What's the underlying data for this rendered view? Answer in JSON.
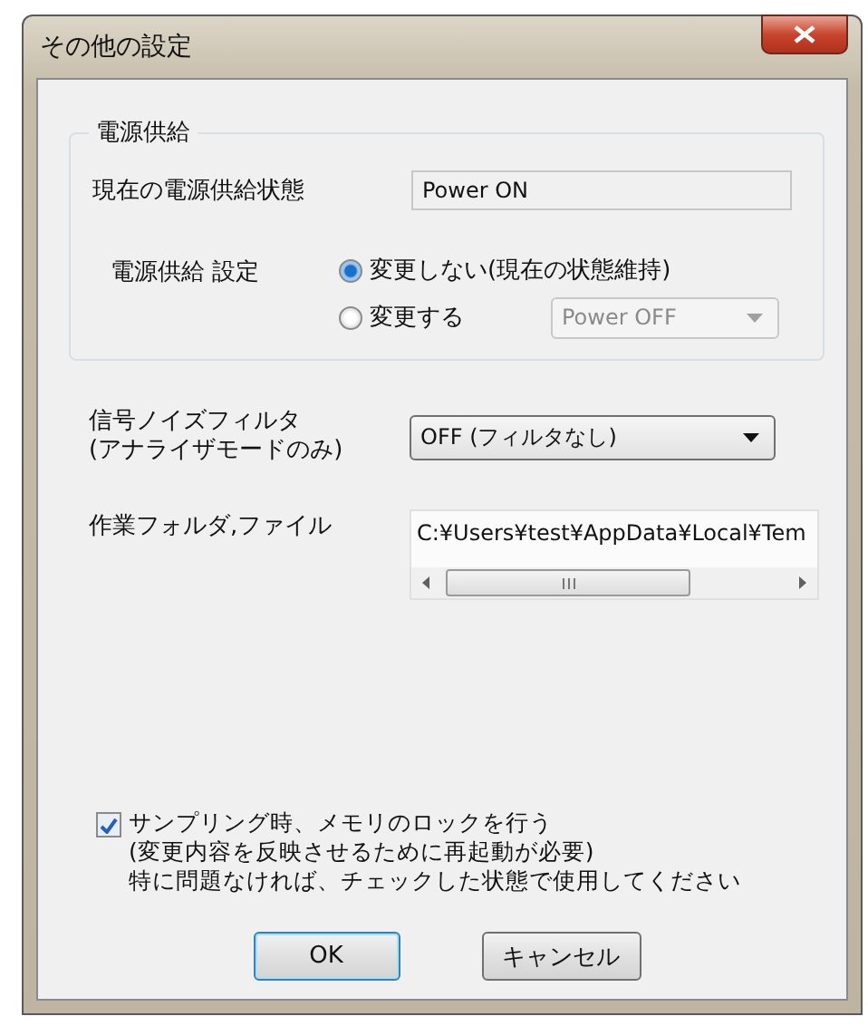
{
  "window": {
    "title": "その他の設定"
  },
  "power_group": {
    "title": "電源供給",
    "current_state": {
      "label": "現在の電源供給状態",
      "value": "Power ON"
    },
    "setting": {
      "label": "電源供給 設定",
      "options": [
        {
          "label": "変更しない(現在の状態維持)",
          "selected": true
        },
        {
          "label": "変更する",
          "selected": false
        }
      ],
      "dropdown": {
        "value": "Power OFF",
        "disabled": true
      }
    }
  },
  "noise_filter": {
    "label_lines": [
      "信号ノイズフィルタ",
      "(アナライザモードのみ)"
    ],
    "dropdown": {
      "value": "OFF (フィルタなし)",
      "disabled": false
    }
  },
  "work_folder": {
    "label": "作業フォルダ,ファイル",
    "value": "C:¥Users¥test¥AppData¥Local¥Tem"
  },
  "memory_lock": {
    "checked": true,
    "label_lines": [
      "サンプリング時、メモリのロックを行う",
      "(変更内容を反映させるために再起動が必要)"
    ],
    "note": "特に問題なければ、チェックした状態で使用してください"
  },
  "buttons": [
    {
      "label": "OK",
      "default": true
    },
    {
      "label": "キャンセル",
      "default": false
    }
  ]
}
